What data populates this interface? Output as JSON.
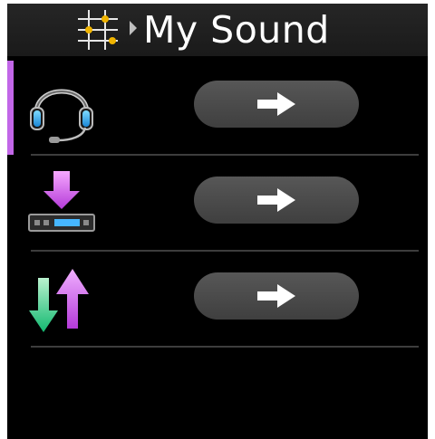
{
  "header": {
    "title": "My Sound",
    "icons": [
      "waveform-icon",
      "mixer-icon",
      "breadcrumb-arrow-icon"
    ]
  },
  "rows": [
    {
      "icon": "headset-icon"
    },
    {
      "icon": "download-to-device-icon"
    },
    {
      "icon": "up-down-arrows-icon"
    }
  ],
  "colors": {
    "accent": "#c267e8",
    "button": "#4a4a4a",
    "background": "#000000",
    "header": "#222222"
  }
}
